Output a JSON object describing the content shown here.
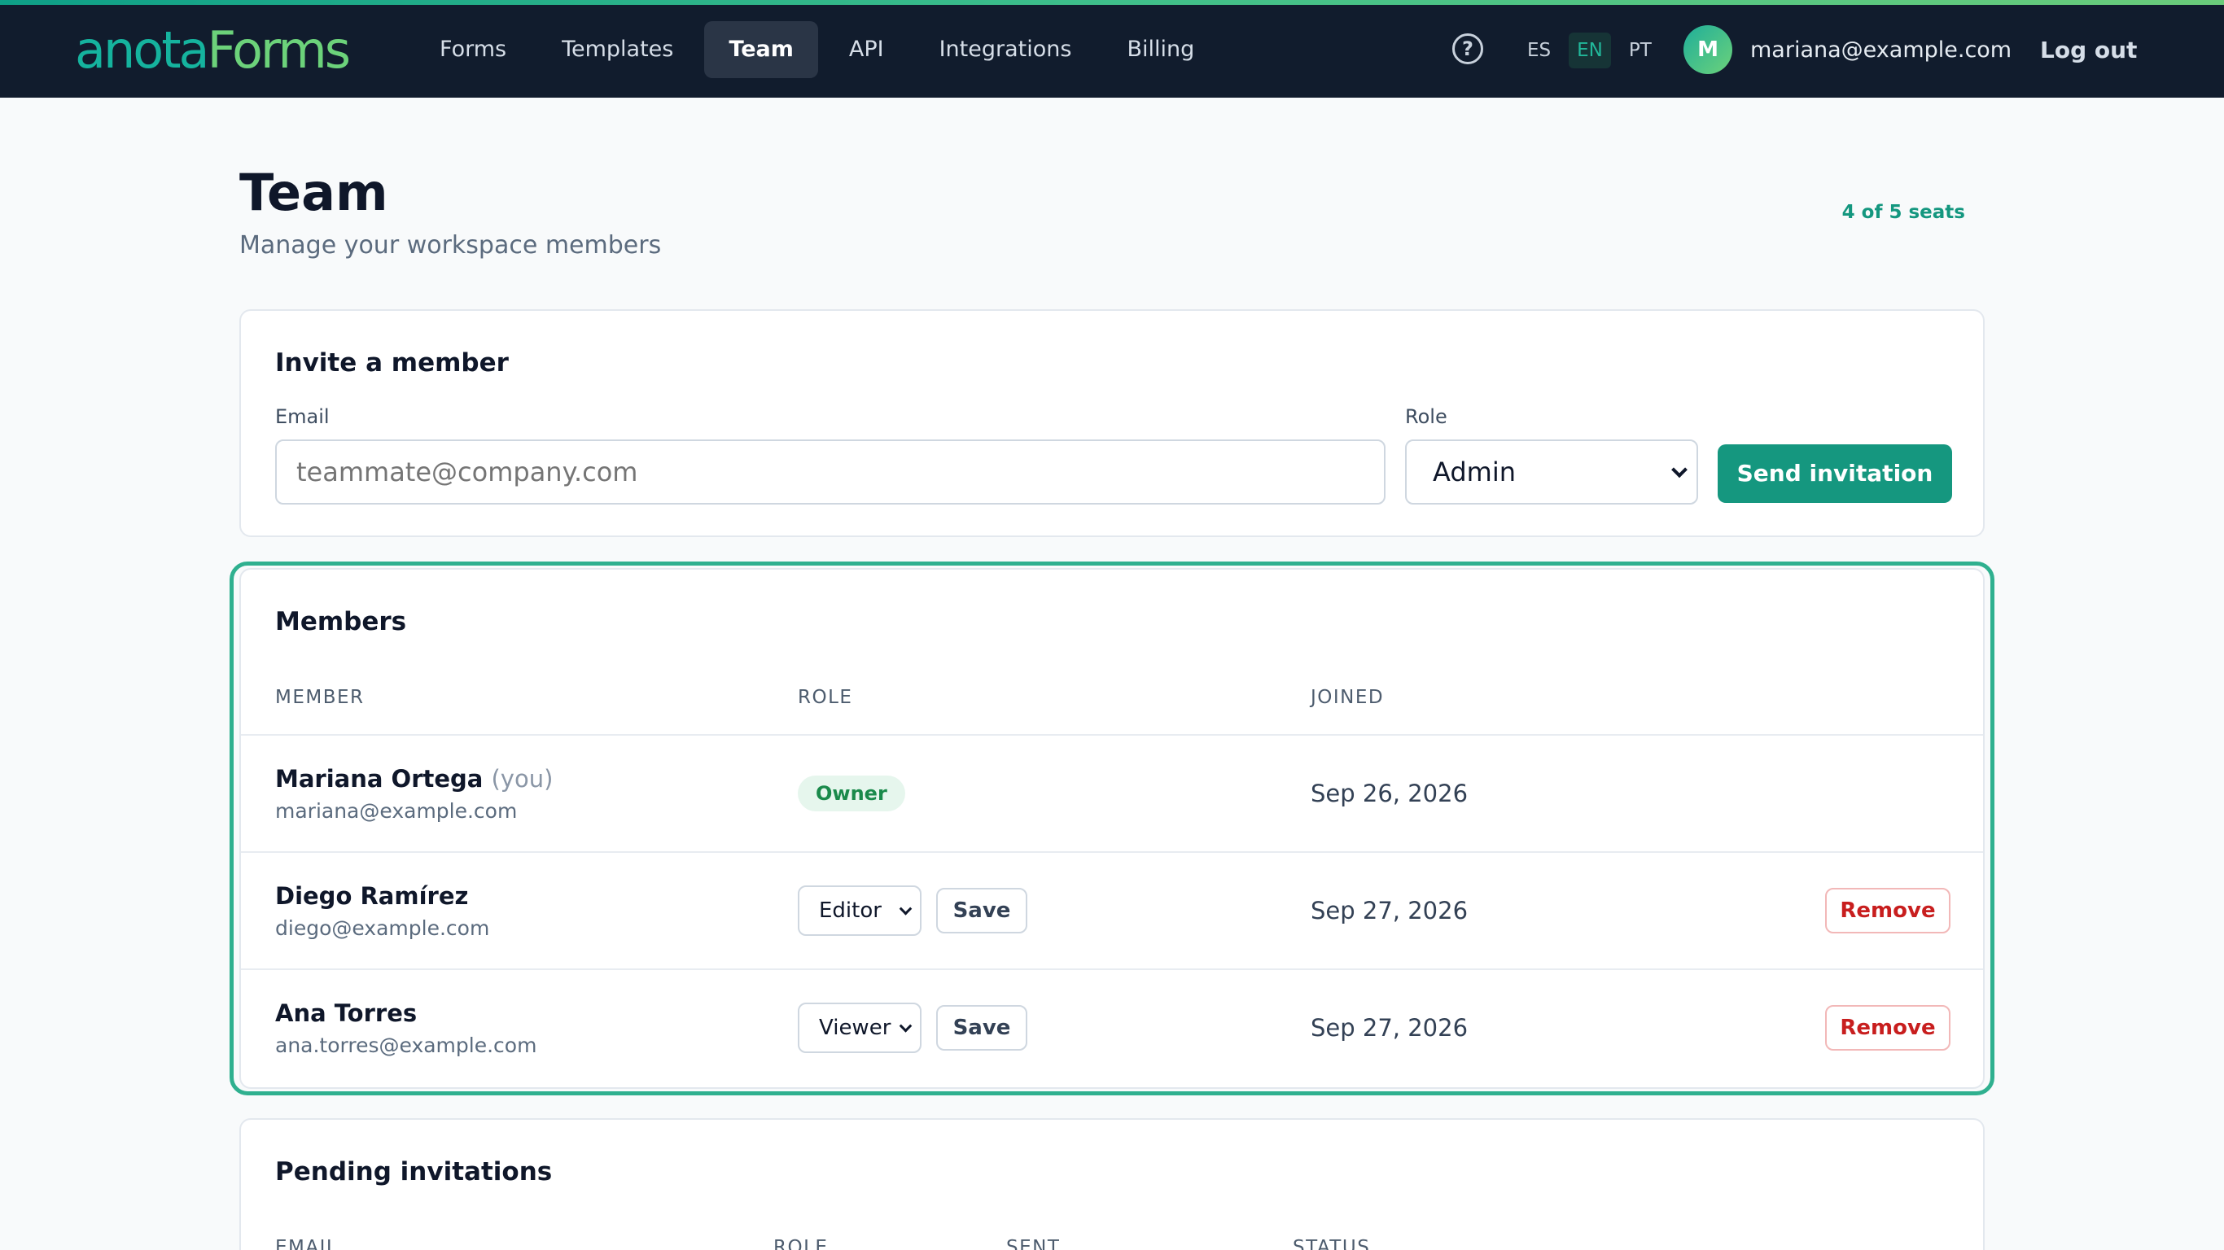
{
  "topbar": {
    "logo_part1": "anota",
    "logo_part2": "Forms",
    "nav": [
      {
        "label": "Forms"
      },
      {
        "label": "Templates"
      },
      {
        "label": "Team"
      },
      {
        "label": "API"
      },
      {
        "label": "Integrations"
      },
      {
        "label": "Billing"
      }
    ],
    "active_nav": "Team",
    "help_icon": "?",
    "languages": [
      "ES",
      "EN",
      "PT"
    ],
    "active_language": "EN",
    "avatar_initial": "M",
    "user_email": "mariana@example.com",
    "logout_label": "Log out"
  },
  "page": {
    "title": "Team",
    "subtitle": "Manage your workspace members",
    "seats": "4 of 5 seats"
  },
  "invite": {
    "title": "Invite a member",
    "email_label": "Email",
    "email_placeholder": "teammate@company.com",
    "role_label": "Role",
    "role_value": "Admin",
    "send_label": "Send invitation"
  },
  "members": {
    "title": "Members",
    "columns": [
      "MEMBER",
      "ROLE",
      "JOINED"
    ],
    "rows": [
      {
        "name": "Mariana Ortega",
        "you": "(you)",
        "email": "mariana@example.com",
        "role": "Owner",
        "joined": "Sep 26, 2026"
      },
      {
        "name": "Diego Ramírez",
        "email": "diego@example.com",
        "role": "Editor",
        "save": "Save",
        "joined": "Sep 27, 2026",
        "remove": "Remove"
      },
      {
        "name": "Ana Torres",
        "email": "ana.torres@example.com",
        "role": "Viewer",
        "save": "Save",
        "joined": "Sep 27, 2026",
        "remove": "Remove"
      }
    ]
  },
  "pending": {
    "title": "Pending invitations",
    "columns": [
      "EMAIL",
      "ROLE",
      "SENT",
      "STATUS"
    ]
  },
  "colors": {
    "topbar_bg": "#111c2d",
    "accent": "#15977f",
    "remove": "#c81e1e",
    "highlight_border": "#2fb08f"
  }
}
